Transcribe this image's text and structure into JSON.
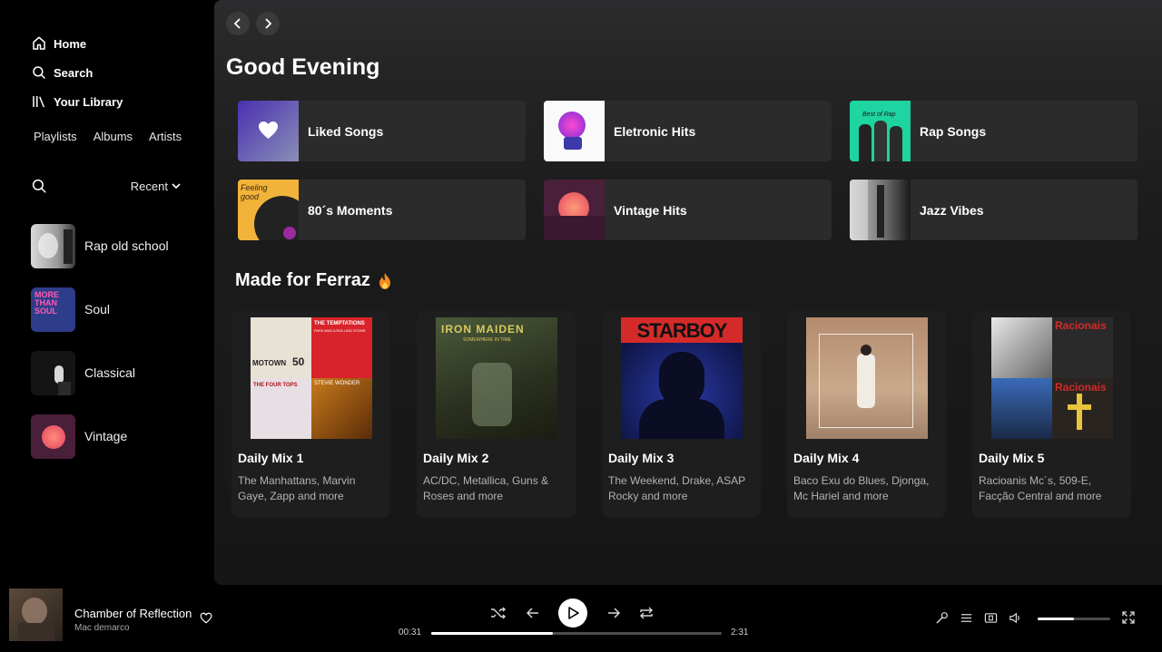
{
  "sidebar": {
    "nav": [
      {
        "label": "Home",
        "icon": "home-icon"
      },
      {
        "label": "Search",
        "icon": "search-icon"
      },
      {
        "label": "Your Library",
        "icon": "library-icon"
      }
    ],
    "filters": [
      "Playlists",
      "Albums",
      "Artists"
    ],
    "sort_label": "Recent",
    "library": [
      {
        "name": "Rap old school"
      },
      {
        "name": "Soul"
      },
      {
        "name": "Classical"
      },
      {
        "name": "Vintage"
      }
    ]
  },
  "main": {
    "greeting": "Good Evening",
    "quick": [
      {
        "label": "Liked Songs"
      },
      {
        "label": "Eletronic Hits"
      },
      {
        "label": "Rap Songs"
      },
      {
        "label": "80´s Moments"
      },
      {
        "label": "Vintage Hits"
      },
      {
        "label": "Jazz Vibes"
      }
    ],
    "section_title": "Made for Ferraz",
    "mixes": [
      {
        "title": "Daily Mix 1",
        "desc": "The Manhattans, Marvin Gaye, Zapp and more"
      },
      {
        "title": "Daily Mix 2",
        "desc": "AC/DC, Metallica, Guns & Roses and more"
      },
      {
        "title": "Daily Mix 3",
        "desc": "The Weekend, Drake, ASAP Rocky and more"
      },
      {
        "title": "Daily Mix 4",
        "desc": "Baco Exu do Blues, Djonga, Mc Hariel and more"
      },
      {
        "title": "Daily Mix 5",
        "desc": "Racioanis Mc´s, 509-E, Facção Central and more"
      }
    ]
  },
  "player": {
    "track": "Chamber of Reflection",
    "artist": "Mac demarco",
    "elapsed": "00:31",
    "duration": "2:31",
    "progress": 0.42,
    "volume": 0.5
  },
  "art_text": {
    "motown": "MOTOWN",
    "motown_num": "50",
    "temptations": "THE TEMPTATIONS",
    "temptations_sub": "PAPA WAS A ROLLING STONE",
    "four_tops": "THE FOUR TOPS",
    "stevie": "STEVIE WONDER",
    "iron": "IRON MAIDEN",
    "iron_sub": "SOMEWHERE IN TIME",
    "starboy": "STARBOY",
    "racionais": "Racionais",
    "more_than_soul": "MORE THAN SOUL",
    "feeling_good": "Feeling good",
    "best_of_rap": "Best of Rap"
  }
}
